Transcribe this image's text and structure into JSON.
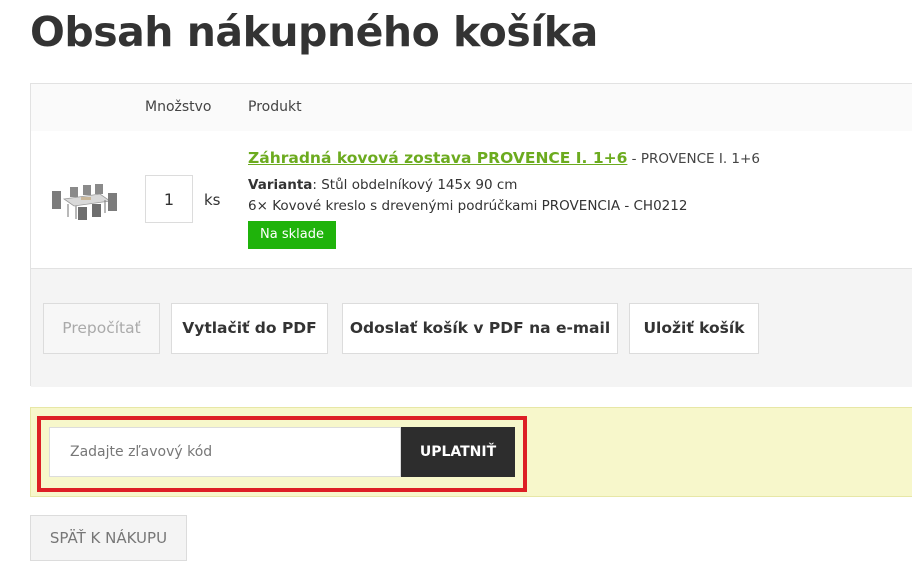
{
  "page": {
    "title": "Obsah nákupného košíka"
  },
  "table": {
    "headers": {
      "quantity": "Množstvo",
      "product": "Produkt"
    }
  },
  "product": {
    "image_icon": "garden-furniture-set-thumbnail",
    "quantity": "1",
    "unit": "ks",
    "name": "Záhradná kovová zostava PROVENCE I. 1+6",
    "code_suffix": " - PROVENCE I. 1+6",
    "variant_label": "Varianta",
    "variant_value": ": Stůl obdelníkový 145x 90 cm",
    "includes": "6× Kovové kreslo s drevenými podrúčkami PROVENCIA - CH0212",
    "stock_status": "Na sklade"
  },
  "actions": {
    "recalculate": "Prepočítať",
    "print_pdf": "Vytlačiť do PDF",
    "send_pdf_email": "Odoslať košík v PDF na e-mail",
    "save_cart": "Uložiť košík"
  },
  "discount": {
    "placeholder": "Zadajte zľavový kód",
    "value": "",
    "apply_label": "UPLATNIŤ"
  },
  "navigation": {
    "back_to_shop": "SPÄŤ K NÁKUPU"
  },
  "colors": {
    "product_link": "#6cab1f",
    "stock_badge": "#1fb30b",
    "highlight": "#dd1f25",
    "discount_background": "#f7f7cb",
    "apply_button": "#2d2d2d"
  }
}
